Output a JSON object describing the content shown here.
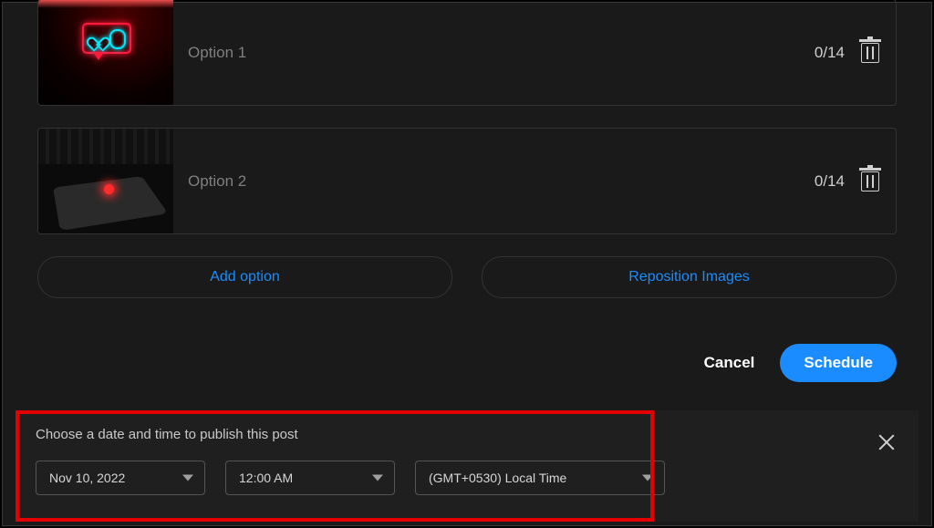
{
  "options": [
    {
      "placeholder": "Option 1",
      "counter": "0/14"
    },
    {
      "placeholder": "Option 2",
      "counter": "0/14"
    }
  ],
  "buttons": {
    "add_option": "Add option",
    "reposition": "Reposition Images",
    "cancel": "Cancel",
    "schedule": "Schedule"
  },
  "scheduler": {
    "title": "Choose a date and time to publish this post",
    "date": "Nov 10, 2022",
    "time": "12:00 AM",
    "timezone": "(GMT+0530) Local Time"
  }
}
